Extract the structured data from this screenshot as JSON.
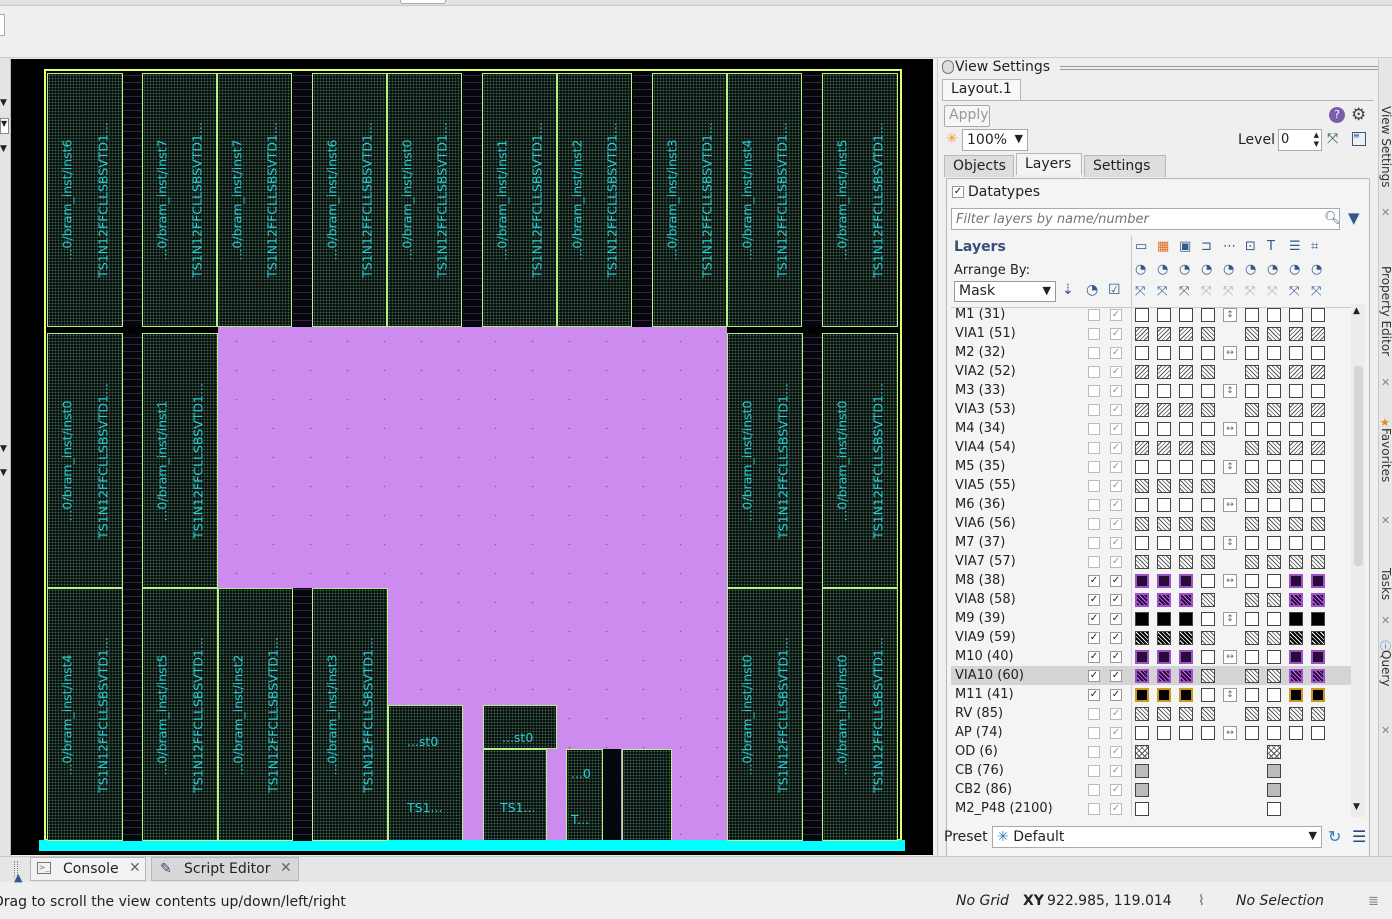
{
  "window": {
    "title": ""
  },
  "layout_cells": {
    "top_row": [
      {
        "left": "...0/bram_inst/inst6",
        "right": "TS1N12FFCLLSBSVTD1..."
      },
      {
        "left": "...0/bram_inst/inst7",
        "right": "TS1N12FFCLLSBSVTD1..."
      },
      {
        "left": "...0/bram_inst/inst7",
        "right": "TS1N12FFCLLSBSVTD1..."
      },
      {
        "left": "...0/bram_inst/inst6",
        "right": "TS1N12FFCLLSBSVTD1..."
      },
      {
        "left": "...0/bram_inst/inst0",
        "right": "TS1N12FFCLLSBSVTD1..."
      },
      {
        "left": "...0/bram_inst/inst1",
        "right": "TS1N12FFCLLSBSVTD1..."
      },
      {
        "left": "...0/bram_inst/inst2",
        "right": "TS1N12FFCLLSBSVTD1..."
      },
      {
        "left": "...0/bram_inst/inst3",
        "right": "TS1N12FFCLLSBSVTD1..."
      },
      {
        "left": "...0/bram_inst/inst4",
        "right": "TS1N12FFCLLSBSVTD1..."
      },
      {
        "left": "...0/bram_inst/inst5",
        "right": "TS1N12FFCLLSBSVTD1..."
      }
    ],
    "mid_left": [
      {
        "left": "...0/bram_inst/inst0",
        "right": "TS1N12FFCLLSBSVTD1..."
      },
      {
        "left": "...0/bram_inst/inst1",
        "right": "TS1N12FFCLLSBSVTD1..."
      }
    ],
    "mid_right": [
      {
        "left": "...0/bram_inst/inst0",
        "right": "TS1N12FFCLLSBSVTD1..."
      },
      {
        "left": "...0/bram_inst/inst0",
        "right": "TS1N12FFCLLSBSVTD1..."
      }
    ],
    "bottom_left": [
      {
        "left": "...0/bram_inst/inst4",
        "right": "TS1N12FFCLLSBSVTD1..."
      },
      {
        "left": "...0/bram_inst/inst5",
        "right": "TS1N12FFCLLSBSVTD1..."
      },
      {
        "left": "...0/bram_inst/inst2",
        "right": "TS1N12FFCLLSBSVTD1..."
      },
      {
        "left": "...0/bram_inst/inst3",
        "right": "TS1N12FFCLLSBSVTD1..."
      }
    ],
    "bottom_right": [
      {
        "left": "...0/bram_inst/inst0",
        "right": "TS1N12FFCLLSBSVTD1..."
      },
      {
        "left": "...0/bram_inst/inst0",
        "right": "TS1N12FFCLLSBSVTD1..."
      }
    ],
    "small": {
      "st0_a": "...st0",
      "st0_b": "...st0",
      "ts1_a": "TS1...",
      "ts1_b": "TS1...",
      "zero": "...0",
      "t": "T..."
    }
  },
  "view_settings": {
    "title": "View Settings",
    "doc_tab": "Layout.1",
    "apply_label": "Apply",
    "zoom": "100%",
    "level_label": "Level",
    "level_value": "0",
    "tabs": [
      "Objects",
      "Layers",
      "Settings"
    ],
    "active_tab": "Layers",
    "datatypes_label": "Datatypes",
    "datatypes_checked": true,
    "filter_placeholder": "Filter layers by name/number",
    "layers_header": "Layers",
    "arrange_by_label": "Arrange By:",
    "arrange_by_value": "Mask",
    "preset_label": "Preset",
    "preset_value": "Default"
  },
  "layers": [
    {
      "name": "M1 (31)",
      "v": false,
      "s": true,
      "fill": "white",
      "dir": "vertical"
    },
    {
      "name": "VIA1 (51)",
      "v": false,
      "s": true,
      "fill": "back",
      "dir": "none"
    },
    {
      "name": "M2 (32)",
      "v": false,
      "s": true,
      "fill": "white",
      "dir": "horizontal"
    },
    {
      "name": "VIA2 (52)",
      "v": false,
      "s": true,
      "fill": "back",
      "dir": "none"
    },
    {
      "name": "M3 (33)",
      "v": false,
      "s": true,
      "fill": "white",
      "dir": "vertical"
    },
    {
      "name": "VIA3 (53)",
      "v": false,
      "s": true,
      "fill": "back",
      "dir": "none"
    },
    {
      "name": "M4 (34)",
      "v": false,
      "s": true,
      "fill": "white",
      "dir": "horizontal"
    },
    {
      "name": "VIA4 (54)",
      "v": false,
      "s": true,
      "fill": "back",
      "dir": "none"
    },
    {
      "name": "M5 (35)",
      "v": false,
      "s": true,
      "fill": "white",
      "dir": "vertical"
    },
    {
      "name": "VIA5 (55)",
      "v": false,
      "s": true,
      "fill": "hatch",
      "dir": "none"
    },
    {
      "name": "M6 (36)",
      "v": false,
      "s": true,
      "fill": "white",
      "dir": "horizontal"
    },
    {
      "name": "VIA6 (56)",
      "v": false,
      "s": true,
      "fill": "hatch",
      "dir": "none"
    },
    {
      "name": "M7 (37)",
      "v": false,
      "s": true,
      "fill": "white",
      "dir": "vertical"
    },
    {
      "name": "VIA7 (57)",
      "v": false,
      "s": true,
      "fill": "hatch",
      "dir": "none"
    },
    {
      "name": "M8 (38)",
      "v": true,
      "s": true,
      "fill": "purple",
      "dir": "horizontal"
    },
    {
      "name": "VIA8 (58)",
      "v": true,
      "s": true,
      "fill": "purplehatch",
      "dir": "none"
    },
    {
      "name": "M9 (39)",
      "v": true,
      "s": true,
      "fill": "black",
      "dir": "vertical"
    },
    {
      "name": "VIA9 (59)",
      "v": true,
      "s": true,
      "fill": "blackhatch",
      "dir": "none"
    },
    {
      "name": "M10 (40)",
      "v": true,
      "s": true,
      "fill": "purple",
      "dir": "horizontal"
    },
    {
      "name": "VIA10 (60)",
      "v": true,
      "s": true,
      "fill": "purplehatch",
      "dir": "none",
      "selected": true
    },
    {
      "name": "M11 (41)",
      "v": true,
      "s": true,
      "fill": "orange",
      "dir": "vertical"
    },
    {
      "name": "RV (85)",
      "v": false,
      "s": true,
      "fill": "hatch",
      "dir": "none"
    },
    {
      "name": "AP (74)",
      "v": false,
      "s": true,
      "fill": "white",
      "dir": "horizontal"
    },
    {
      "name": "OD (6)",
      "v": false,
      "s": true,
      "fill": "cross",
      "dir": "none",
      "short": true
    },
    {
      "name": "CB (76)",
      "v": false,
      "s": true,
      "fill": "gray",
      "dir": "none",
      "short": true
    },
    {
      "name": "CB2 (86)",
      "v": false,
      "s": true,
      "fill": "gray",
      "dir": "none",
      "short": true
    },
    {
      "name": "M2_P48 (2100)",
      "v": false,
      "s": true,
      "fill": "white",
      "dir": "none",
      "short": true
    }
  ],
  "side_tabs": [
    "View Settings",
    "Property Editor",
    "Favorites",
    "Tasks",
    "Query"
  ],
  "bottom_tabs": [
    {
      "label": "Console"
    },
    {
      "label": "Script Editor"
    }
  ],
  "status": {
    "hint": "Drag to scroll the view contents up/down/left/right",
    "grid": "No Grid",
    "xy_label": "XY",
    "xy_value": "922.985, 119.014",
    "selection": "No Selection"
  },
  "colors": {
    "layout_bg": "#000000",
    "cell_border": "#b8f08a",
    "label": "#24d0d6",
    "macro": "#cd8bef",
    "bottom_bar": "#00ffff"
  }
}
